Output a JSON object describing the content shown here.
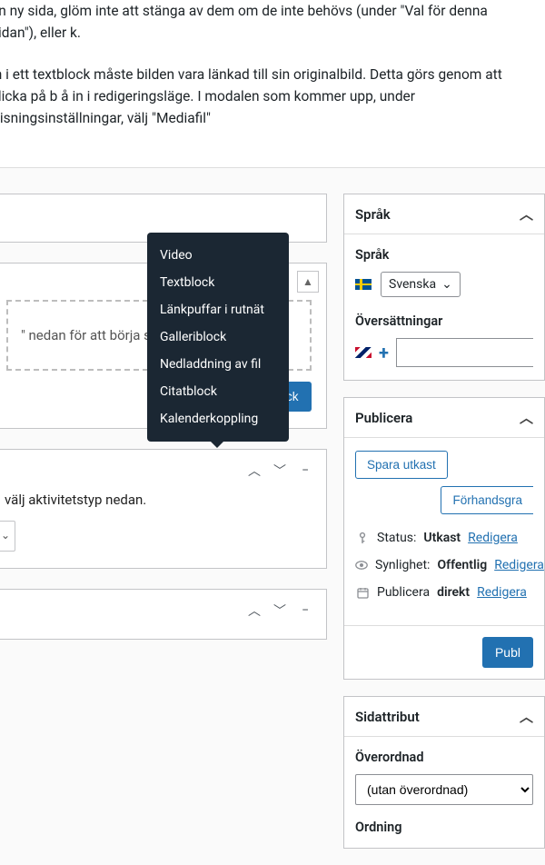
{
  "intro": {
    "p1": "en ny sida, glöm inte att stänga av dem om de inte behövs (under \"Val för denna sidan\"), eller k.",
    "p2": "in i ett textblock måste bilden vara länkad till sin originalbild. Detta görs genom att klicka på b å in i redigeringsläge. I modalen som kommer upp, under Visningsinställningar, välj \"Mediafil\" "
  },
  "content": {
    "placeholder": "\" nedan för att börja skapa",
    "add_block": "Lägg till innehållsblock"
  },
  "popover": {
    "items": [
      "Video",
      "Textblock",
      "Länkpuffar i rutnät",
      "Galleriblock",
      "Nedladdning av fil",
      "Citatblock",
      "Kalenderkoppling"
    ]
  },
  "activity": {
    "text": "välj aktivitetstyp nedan."
  },
  "language": {
    "title": "Språk",
    "label": "Språk",
    "selected": "Svenska",
    "translations_label": "Översättningar"
  },
  "publish": {
    "title": "Publicera",
    "save_draft": "Spara utkast",
    "preview": "Förhandsgra",
    "status_label": "Status:",
    "status_value": "Utkast",
    "visibility_label": "Synlighet:",
    "visibility_value": "Offentlig",
    "publish_label": "Publicera",
    "publish_value": "direkt",
    "edit": "Redigera",
    "publish_btn": "Publ"
  },
  "attributes": {
    "title": "Sidattribut",
    "parent_label": "Överordnad",
    "parent_value": "(utan överordnad)",
    "order_label": "Ordning"
  }
}
